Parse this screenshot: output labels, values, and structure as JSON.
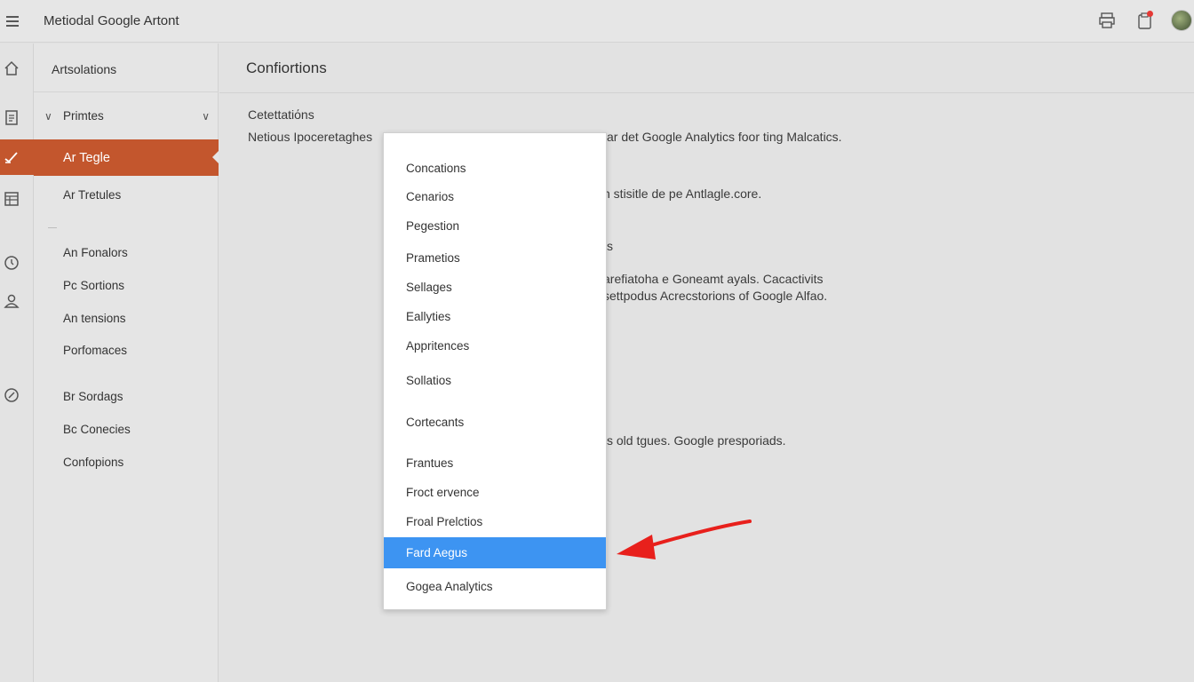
{
  "app": {
    "title": "Metiodal Google Artont"
  },
  "header_icons": [
    "printer-icon",
    "clipboard-notification-icon",
    "user-avatar"
  ],
  "rail": {
    "icons": [
      "home-icon",
      "report-icon",
      "pulse-icon",
      "table-icon",
      "clock-icon",
      "user-icon",
      "compass-icon"
    ]
  },
  "sidebar": {
    "header": "Artsolations",
    "group": {
      "label": "Primtes"
    },
    "active_item": "Ar Tegle",
    "items": [
      "Ar Tretules",
      "An Fonalors",
      "Pc Sortions",
      "An tensions",
      "Porfomaces",
      "Br Sordags",
      "Bc Conecies",
      "Confopions"
    ]
  },
  "main": {
    "title": "Confiortions",
    "section_label": "Cetettatiόns",
    "paragraph_lines": [
      "Netious Ipoceretaghes",
      "ar det Google Analytics foor ting Malcatics.",
      "n stisitle de pe Antlagle.core.",
      "s",
      "arefiatoha e Goneamt ayals. Cacactivits",
      "settpodus Acrecstorions of Google Alfao.",
      "s old tgues. Google presporiads."
    ]
  },
  "dropdown": {
    "options": [
      "Concations",
      "Cenarios",
      "Pegestion",
      "Prametios",
      "Sellages",
      "Eallyties",
      "Appritences",
      "Sollatios",
      "Cortecants",
      "Frantues",
      "Froct ervence",
      "Froal Prelctios",
      "Fard Aegus",
      "Gogea Analytics"
    ],
    "selected": "Fard Aegus"
  },
  "colors": {
    "accent": "#c3562d",
    "selection": "#3d94f2",
    "arrow": "#e8201c"
  }
}
